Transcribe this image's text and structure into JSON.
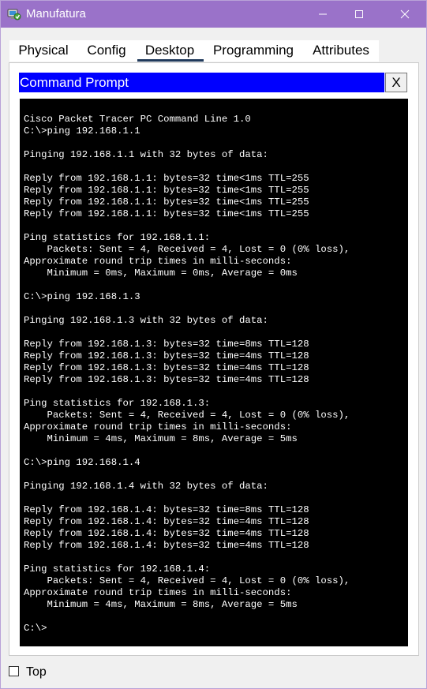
{
  "window": {
    "title": "Manufatura",
    "icon": "packet-tracer-pc-icon"
  },
  "tabs": [
    {
      "label": "Physical",
      "selected": false
    },
    {
      "label": "Config",
      "selected": false
    },
    {
      "label": "Desktop",
      "selected": true
    },
    {
      "label": "Programming",
      "selected": false
    },
    {
      "label": "Attributes",
      "selected": false
    }
  ],
  "command_prompt": {
    "title": "Command Prompt",
    "close_label": "X",
    "lines": [
      "Cisco Packet Tracer PC Command Line 1.0",
      "C:\\>ping 192.168.1.1",
      "",
      "Pinging 192.168.1.1 with 32 bytes of data:",
      "",
      "Reply from 192.168.1.1: bytes=32 time<1ms TTL=255",
      "Reply from 192.168.1.1: bytes=32 time<1ms TTL=255",
      "Reply from 192.168.1.1: bytes=32 time<1ms TTL=255",
      "Reply from 192.168.1.1: bytes=32 time<1ms TTL=255",
      "",
      "Ping statistics for 192.168.1.1:",
      "    Packets: Sent = 4, Received = 4, Lost = 0 (0% loss),",
      "Approximate round trip times in milli-seconds:",
      "    Minimum = 0ms, Maximum = 0ms, Average = 0ms",
      "",
      "C:\\>ping 192.168.1.3",
      "",
      "Pinging 192.168.1.3 with 32 bytes of data:",
      "",
      "Reply from 192.168.1.3: bytes=32 time=8ms TTL=128",
      "Reply from 192.168.1.3: bytes=32 time=4ms TTL=128",
      "Reply from 192.168.1.3: bytes=32 time=4ms TTL=128",
      "Reply from 192.168.1.3: bytes=32 time=4ms TTL=128",
      "",
      "Ping statistics for 192.168.1.3:",
      "    Packets: Sent = 4, Received = 4, Lost = 0 (0% loss),",
      "Approximate round trip times in milli-seconds:",
      "    Minimum = 4ms, Maximum = 8ms, Average = 5ms",
      "",
      "C:\\>ping 192.168.1.4",
      "",
      "Pinging 192.168.1.4 with 32 bytes of data:",
      "",
      "Reply from 192.168.1.4: bytes=32 time=8ms TTL=128",
      "Reply from 192.168.1.4: bytes=32 time=4ms TTL=128",
      "Reply from 192.168.1.4: bytes=32 time=4ms TTL=128",
      "Reply from 192.168.1.4: bytes=32 time=4ms TTL=128",
      "",
      "Ping statistics for 192.168.1.4:",
      "    Packets: Sent = 4, Received = 4, Lost = 0 (0% loss),",
      "Approximate round trip times in milli-seconds:",
      "    Minimum = 4ms, Maximum = 8ms, Average = 5ms",
      "",
      "C:\\>"
    ]
  },
  "footer": {
    "top_label": "Top",
    "top_checked": false
  },
  "colors": {
    "titlebar": "#9a72c9",
    "cmd_header": "#0000ff",
    "terminal_bg": "#000000",
    "terminal_fg": "#ffffff"
  }
}
